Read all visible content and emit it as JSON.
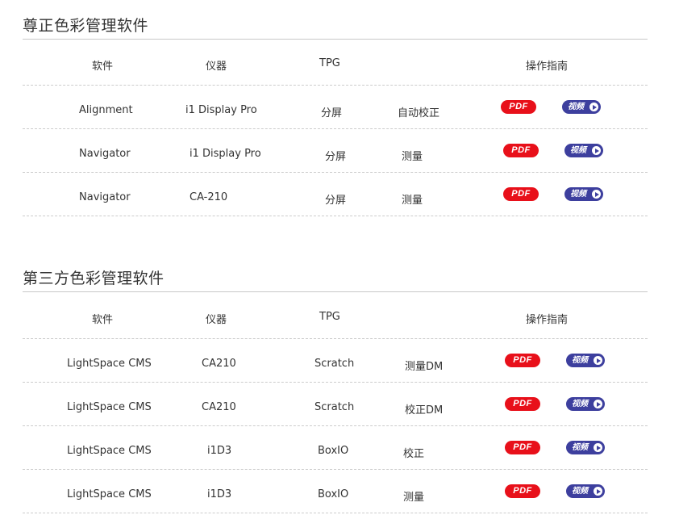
{
  "sections": [
    {
      "title": "尊正色彩管理软件",
      "headers": {
        "software": "软件",
        "instrument": "仪器",
        "tpg": "TPG",
        "guide": "操作指南"
      },
      "rows": [
        {
          "software": "Alignment",
          "instrument": "i1 Display Pro",
          "tpg": "分屏",
          "mode": "自动校正",
          "pdf": "PDF",
          "video": "视频"
        },
        {
          "software": "Navigator",
          "instrument": "i1 Display Pro",
          "tpg": "分屏",
          "mode": "测量",
          "pdf": "PDF",
          "video": "视频"
        },
        {
          "software": "Navigator",
          "instrument": "CA-210",
          "tpg": "分屏",
          "mode": "测量",
          "pdf": "PDF",
          "video": "视频"
        }
      ]
    },
    {
      "title": "第三方色彩管理软件",
      "headers": {
        "software": "软件",
        "instrument": "仪器",
        "tpg": "TPG",
        "guide": "操作指南"
      },
      "rows": [
        {
          "software": "LightSpace CMS",
          "instrument": "CA210",
          "tpg": "Scratch",
          "mode": "测量DM",
          "pdf": "PDF",
          "video": "视频"
        },
        {
          "software": "LightSpace CMS",
          "instrument": "CA210",
          "tpg": "Scratch",
          "mode": "校正DM",
          "pdf": "PDF",
          "video": "视频"
        },
        {
          "software": "LightSpace CMS",
          "instrument": "i1D3",
          "tpg": "BoxIO",
          "mode": "校正",
          "pdf": "PDF",
          "video": "视频"
        },
        {
          "software": "LightSpace CMS",
          "instrument": "i1D3",
          "tpg": "BoxIO",
          "mode": "测量",
          "pdf": "PDF",
          "video": "视频"
        }
      ]
    }
  ],
  "colors": {
    "pdf_button": "#e8101a",
    "video_button": "#3d3f9e",
    "divider": "#cccccc"
  }
}
